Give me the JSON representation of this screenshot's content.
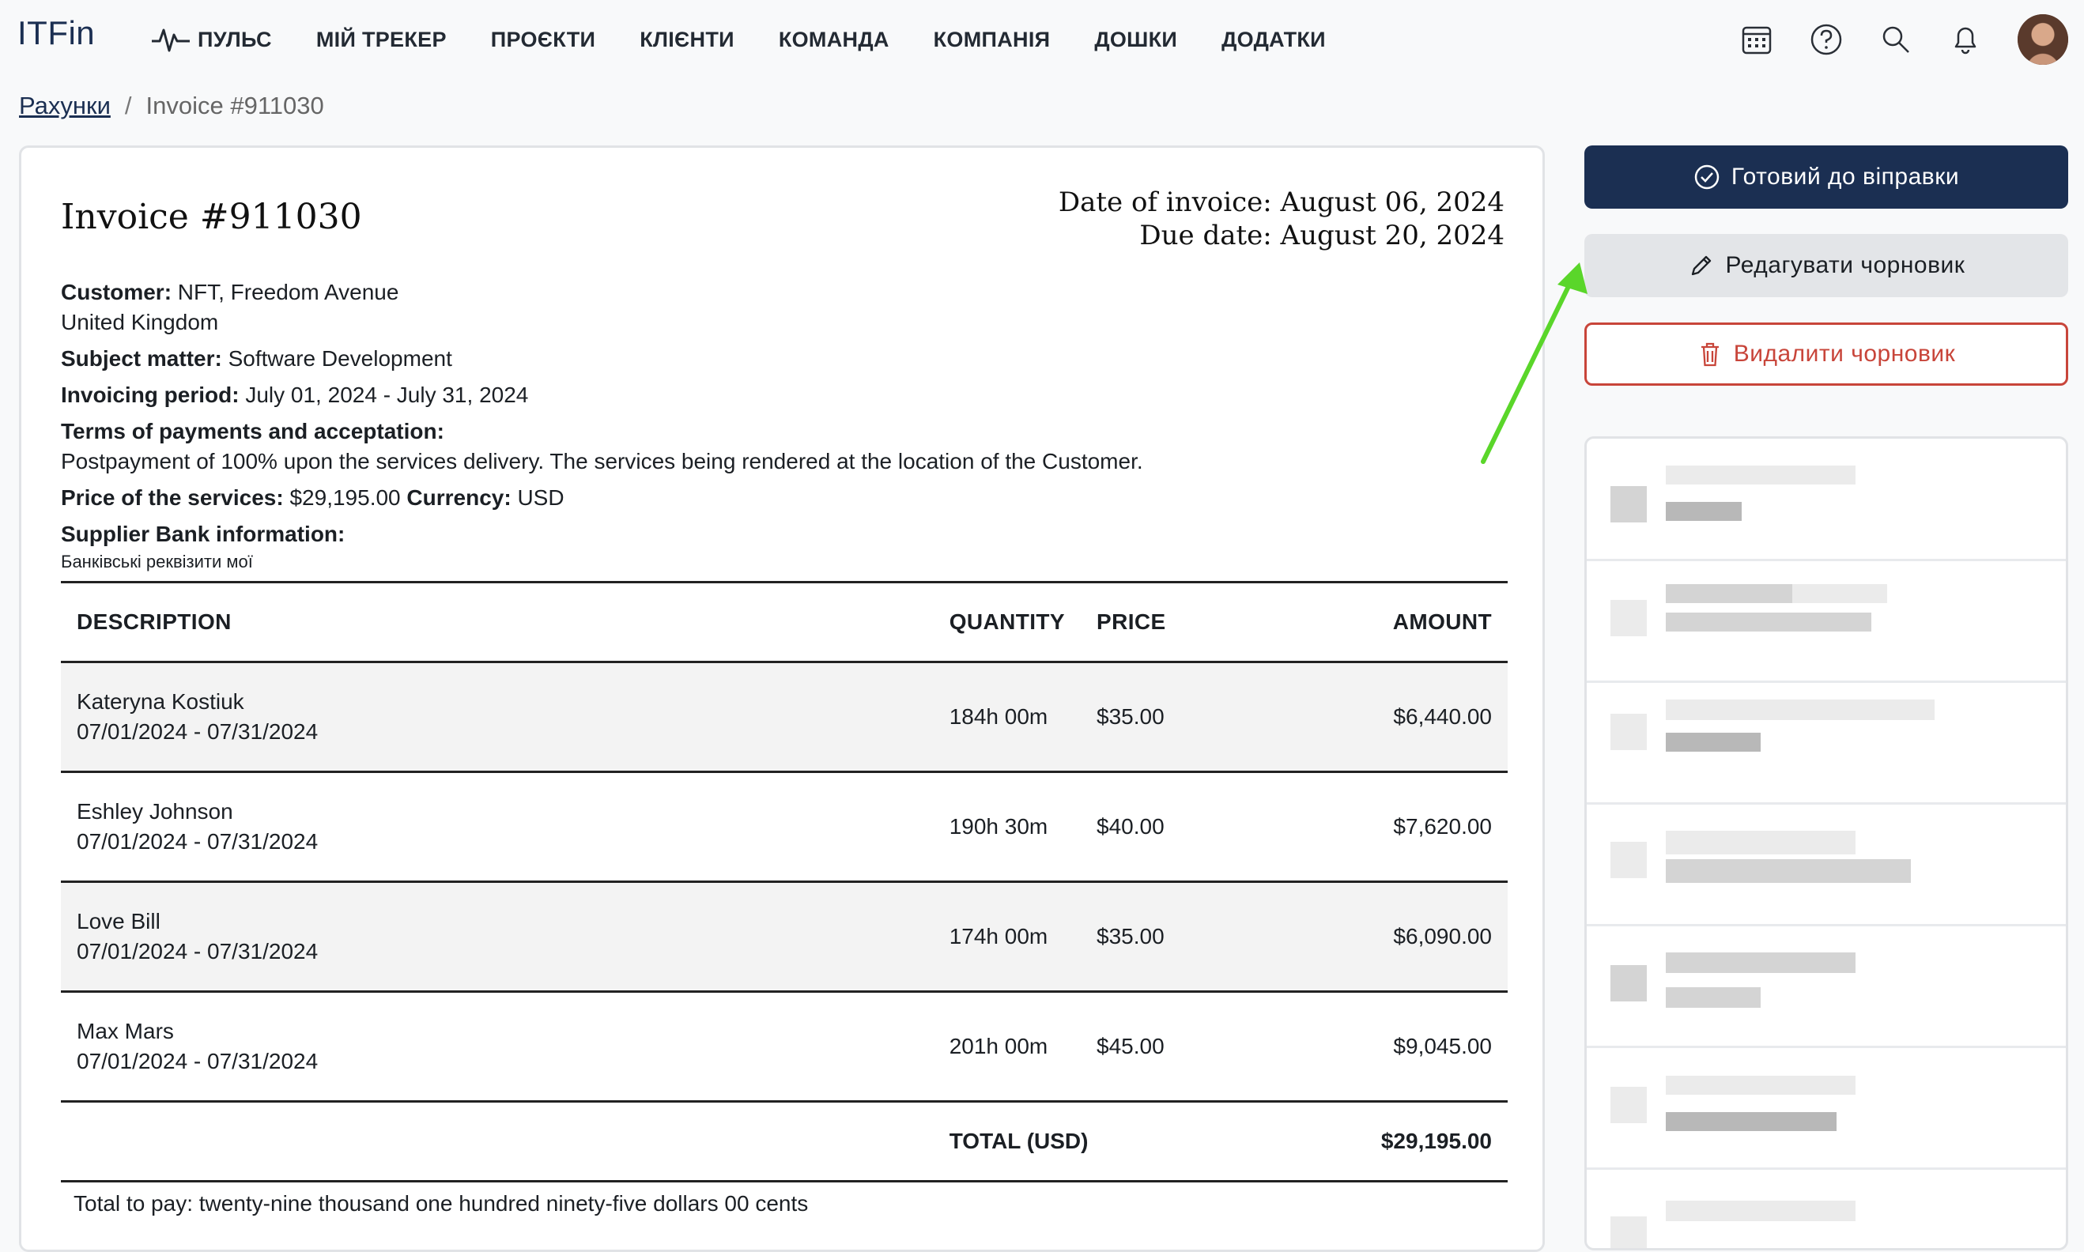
{
  "app": {
    "logo": "ITFin"
  },
  "nav": {
    "items": [
      "ПУЛЬС",
      "МІЙ ТРЕКЕР",
      "ПРОЄКТИ",
      "КЛІЄНТИ",
      "КОМАНДА",
      "КОМПАНІЯ",
      "ДОШКИ",
      "ДОДАТКИ"
    ]
  },
  "icons": [
    "pulse-icon",
    "calendar-icon",
    "help-icon",
    "search-icon",
    "bell-icon"
  ],
  "breadcrumb": {
    "parent": "Рахунки",
    "separator": "/",
    "current": "Invoice #911030"
  },
  "invoice": {
    "title": "Invoice #911030",
    "date_of_invoice": "Date of invoice: August 06, 2024",
    "due_date": "Due date: August 20, 2024",
    "customer_label": "Customer:",
    "customer_value": "NFT, Freedom Avenue",
    "customer_country": "United Kingdom",
    "subject_label": "Subject matter:",
    "subject_value": "Software Development",
    "period_label": "Invoicing period:",
    "period_value": "July 01, 2024 - July 31, 2024",
    "terms_label": "Terms of payments and acceptation:",
    "terms_value": "Postpayment of 100% upon the services delivery. The services being rendered at the location of the Customer.",
    "price_label": "Price of the services:",
    "price_value": "$29,195.00",
    "currency_label": "Currency:",
    "currency_value": "USD",
    "bank_label": "Supplier Bank information:",
    "bank_value": "Банківські реквізити мої",
    "table": {
      "headers": {
        "description": "DESCRIPTION",
        "quantity": "QUANTITY",
        "price": "PRICE",
        "amount": "AMOUNT"
      },
      "rows": [
        {
          "name": "Kateryna Kostiuk",
          "period": "07/01/2024 - 07/31/2024",
          "quantity": "184h 00m",
          "price": "$35.00",
          "amount": "$6,440.00"
        },
        {
          "name": "Eshley Johnson",
          "period": "07/01/2024 - 07/31/2024",
          "quantity": "190h 30m",
          "price": "$40.00",
          "amount": "$7,620.00"
        },
        {
          "name": "Love Bill",
          "period": "07/01/2024 - 07/31/2024",
          "quantity": "174h 00m",
          "price": "$35.00",
          "amount": "$6,090.00"
        },
        {
          "name": "Max Mars",
          "period": "07/01/2024 - 07/31/2024",
          "quantity": "201h 00m",
          "price": "$45.00",
          "amount": "$9,045.00"
        }
      ],
      "total_label": "TOTAL (USD)",
      "total_value": "$29,195.00"
    },
    "total_to_pay": "Total to pay: twenty-nine thousand one hundred ninety-five dollars 00 cents"
  },
  "actions": {
    "ready": "Готовий до віправки",
    "edit": "Редагувати чорновик",
    "delete": "Видалити чорновик"
  },
  "colors": {
    "primary": "#1b2f52",
    "danger": "#c8453a",
    "arrow": "#5ad62a"
  }
}
